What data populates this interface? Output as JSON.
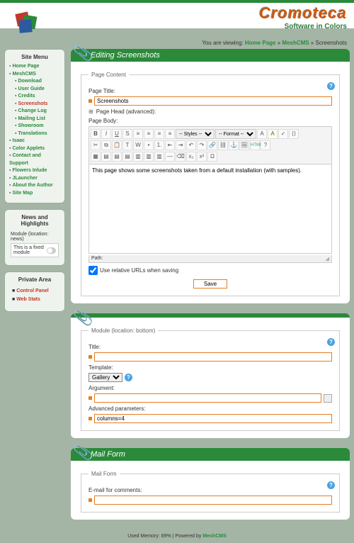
{
  "brand": {
    "name": "Cromoteca",
    "tagline": "Software in Colors"
  },
  "breadcrumb": {
    "prefix": "You are viewing:",
    "items": [
      "Home Page",
      "MeshCMS",
      "Screenshots"
    ]
  },
  "sidebar": {
    "siteMenuTitle": "Site Menu",
    "items": [
      {
        "label": "Home Page",
        "sub": false
      },
      {
        "label": "MeshCMS",
        "sub": false
      },
      {
        "label": "Download",
        "sub": true
      },
      {
        "label": "User Guide",
        "sub": true
      },
      {
        "label": "Credits",
        "sub": true
      },
      {
        "label": "Screenshots",
        "sub": true,
        "current": true
      },
      {
        "label": "Change Log",
        "sub": true
      },
      {
        "label": "Mailing List",
        "sub": true
      },
      {
        "label": "Showroom",
        "sub": true
      },
      {
        "label": "Translations",
        "sub": true
      },
      {
        "label": "Isaac",
        "sub": false
      },
      {
        "label": "Color Applets",
        "sub": false
      },
      {
        "label": "Contact and Support",
        "sub": false
      },
      {
        "label": "Flowers Inlude",
        "sub": false
      },
      {
        "label": "JLauncher",
        "sub": false
      },
      {
        "label": "About the Author",
        "sub": false
      },
      {
        "label": "Site Map",
        "sub": false
      }
    ],
    "newsTitle": "News and Highlights",
    "newsModuleLabel": "Module (location: news)",
    "newsFixed": "This is a fixed module",
    "privateTitle": "Private Area",
    "privateItems": [
      "Control Panel",
      "Web Stats"
    ]
  },
  "editor": {
    "heading": "Editing Screenshots",
    "legend": "Page Content",
    "pageTitleLabel": "Page Title:",
    "pageTitleValue": "Screenshots",
    "pageHeadLabel": "Page Head (advanced):",
    "pageBodyLabel": "Page Body:",
    "stylesLabel": "-- Styles --",
    "formatLabel": "-- Format --",
    "bodyText": "This page shows some screenshots taken from a default installation (with samples).",
    "pathLabel": "Path:",
    "relUrls": "Use relative URLs when saving",
    "saveLabel": "Save"
  },
  "module": {
    "legend": "Module (location: bottom)",
    "titleLabel": "Title:",
    "titleValue": "",
    "templateLabel": "Template:",
    "templateValue": "Gallery",
    "argLabel": "Argument:",
    "argValue": "",
    "advLabel": "Advanced parameters:",
    "advValue": "columns=4"
  },
  "mail": {
    "heading": "Mail Form",
    "legend": "Mail Form",
    "emailLabel": "E-mail for comments:",
    "emailValue": ""
  },
  "footer": {
    "text": "Used Memory: 89% | Powered by ",
    "link": "MeshCMS"
  }
}
